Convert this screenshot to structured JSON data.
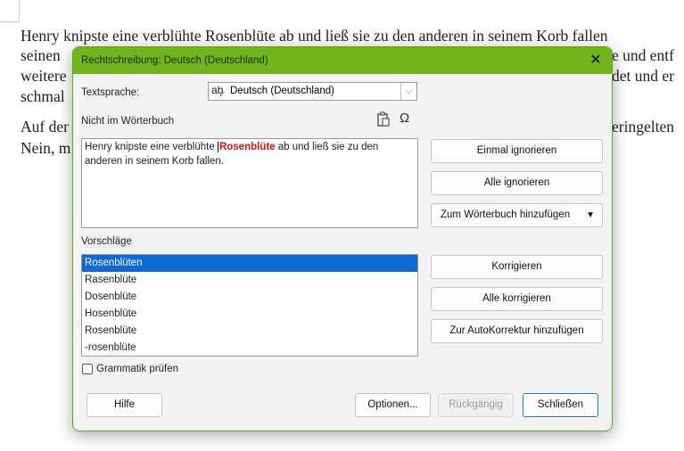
{
  "document": {
    "lines": [
      "Henry knipste eine verblühte Rosenblüte ab und ließ sie zu den anderen in seinem Korb fallen",
      "seinen",
      "e und entf",
      "weitere",
      "det und er",
      "schmal",
      "Auf der",
      "eringelten",
      "Nein, m"
    ]
  },
  "dialog": {
    "title": "Rechtschreibung: Deutsch (Deutschland)",
    "close_glyph": "✕",
    "text_language_label": "Textsprache:",
    "text_language_value": "Deutsch (Deutschland)",
    "not_in_dictionary_label": "Nicht im Wörterbuch",
    "sentence": {
      "before": "Henry knipste eine verblühte ",
      "error": "Rosenblüte",
      "after": " ab und ließ sie zu den anderen in seinem Korb fallen."
    },
    "suggestions_label": "Vorschläge",
    "suggestions": [
      "Rosenblüten",
      "Rasenblüte",
      "Dosenblüte",
      "Hosenblüte",
      "Rosenblüte",
      "-rosenblüte"
    ],
    "grammar_check_label": "Grammatik prüfen",
    "buttons": {
      "ignore_once": "Einmal ignorieren",
      "ignore_all": "Alle ignorieren",
      "add_to_dictionary": "Zum Wörterbuch hinzufügen",
      "correct": "Korrigieren",
      "correct_all": "Alle korrigieren",
      "add_autocorrect": "Zur AutoKorrektur hinzufügen",
      "help": "Hilfe",
      "options": "Optionen...",
      "undo": "Rückgängig",
      "close": "Schließen"
    }
  },
  "colors": {
    "titlebar": "#6fb51b",
    "selection": "#0b6ad6",
    "error_word": "#e01010"
  }
}
